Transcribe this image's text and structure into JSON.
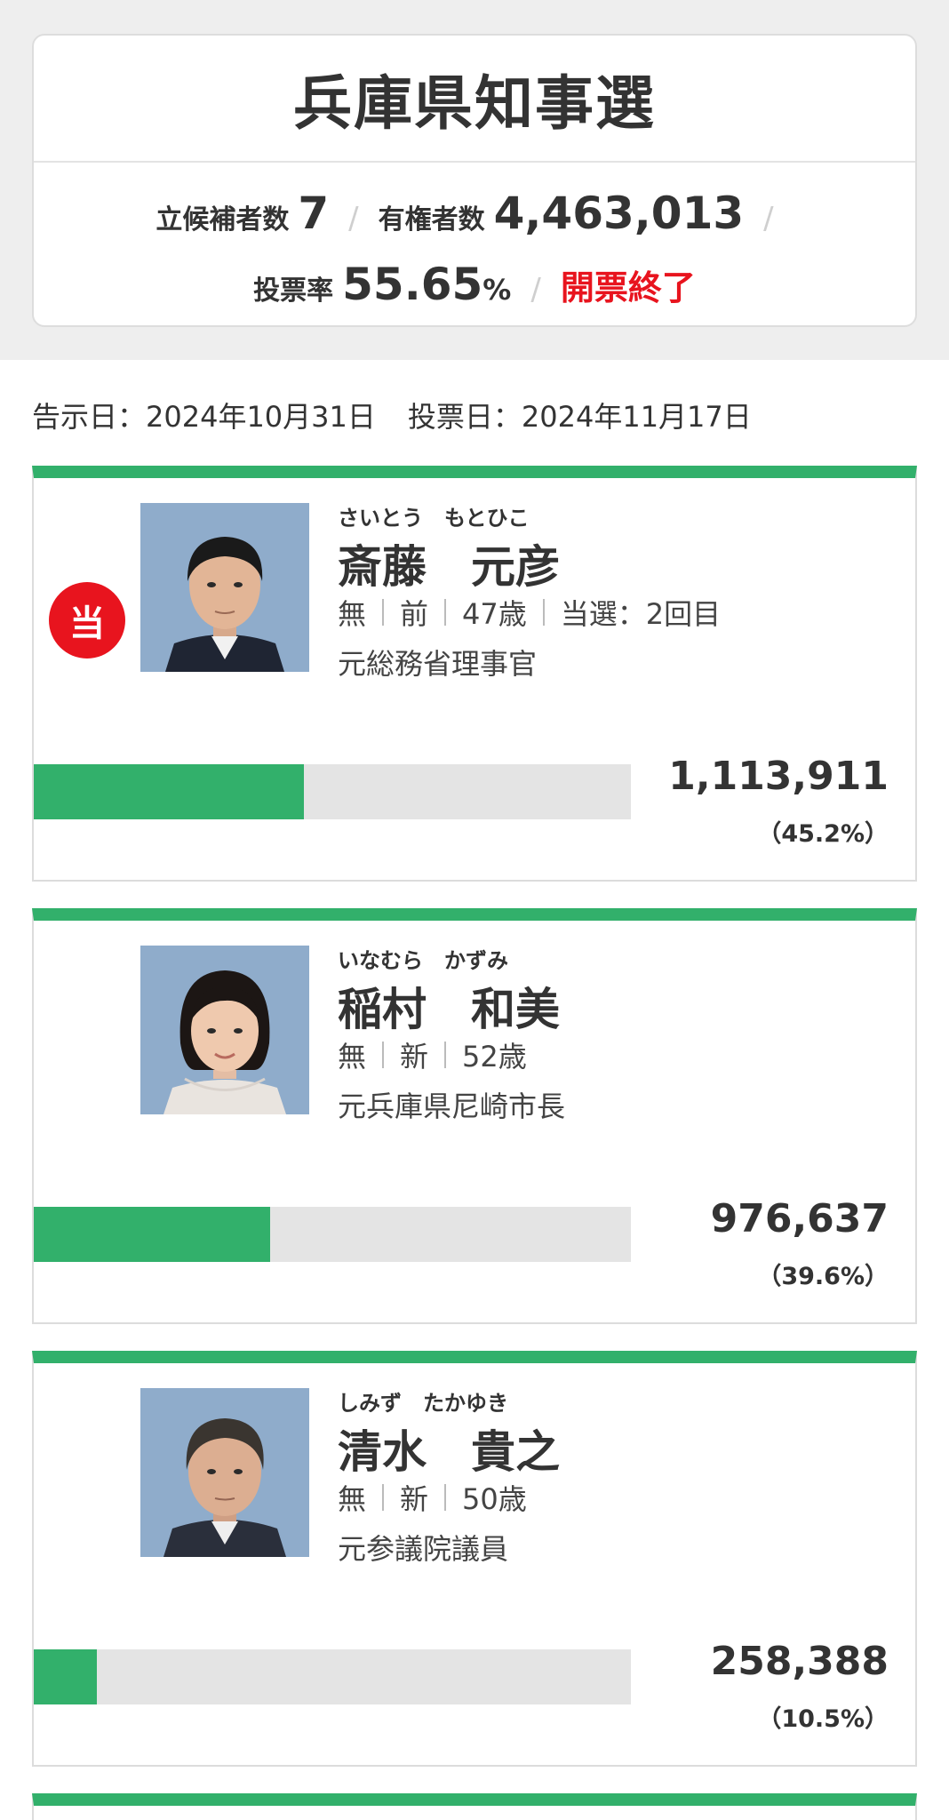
{
  "colors": {
    "accent_green": "#32b06b",
    "elected_red": "#e8141e",
    "bar_track": "#e4e4e4"
  },
  "summary": {
    "title": "兵庫県知事選",
    "candidates_label": "立候補者数",
    "candidates_value": "7",
    "voters_label": "有権者数",
    "voters_value": "4,463,013",
    "turnout_label": "投票率",
    "turnout_value": "55.65",
    "turnout_unit": "%",
    "separator": "/",
    "status": "開票終了"
  },
  "dates": {
    "notice": "告示日：2024年10月31日",
    "vote": "投票日：2024年11月17日"
  },
  "candidates": [
    {
      "elected_badge": "当",
      "photo_icon": "candidate-portrait-man",
      "kana": "さいとう　もとひこ",
      "name": "斎藤　元彦",
      "party": "無",
      "status": "前",
      "age": "47歳",
      "term": "当選：2回目",
      "career": "元総務省理事官",
      "votes": "1,113,911",
      "percent_label": "（45.2%）",
      "share": 0.452
    },
    {
      "photo_icon": "candidate-portrait-woman",
      "kana": "いなむら　かずみ",
      "name": "稲村　和美",
      "party": "無",
      "status": "新",
      "age": "52歳",
      "career": "元兵庫県尼崎市長",
      "votes": "976,637",
      "percent_label": "（39.6%）",
      "share": 0.396
    },
    {
      "photo_icon": "candidate-portrait-man",
      "kana": "しみず　たかゆき",
      "name": "清水　貴之",
      "party": "無",
      "status": "新",
      "age": "50歳",
      "career": "元参議院議員",
      "votes": "258,388",
      "percent_label": "（10.5%）",
      "share": 0.105
    }
  ]
}
